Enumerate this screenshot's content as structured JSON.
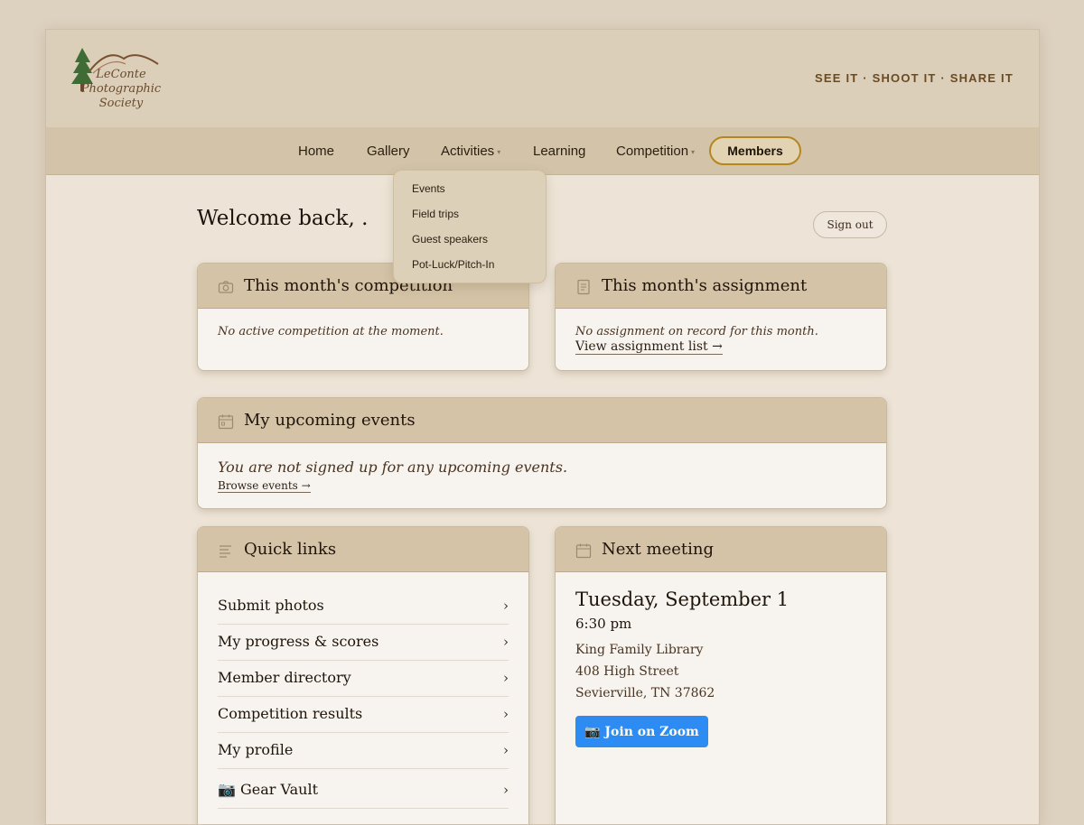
{
  "header": {
    "logo": {
      "line1": "LeConte",
      "line2": "Photographic",
      "line3": "Society"
    },
    "tagline": "SEE IT · SHOOT IT · SHARE IT"
  },
  "nav": {
    "items": [
      {
        "label": "Home"
      },
      {
        "label": "Gallery"
      },
      {
        "label": "Activities",
        "has_dropdown": true
      },
      {
        "label": "Learning"
      },
      {
        "label": "Competition",
        "has_dropdown": true
      }
    ],
    "members_label": "Members",
    "dropdown": {
      "parent": "Activities",
      "items": [
        "Events",
        "Field trips",
        "Guest speakers",
        "Pot-Luck/Pitch-In"
      ]
    }
  },
  "welcome": {
    "text": "Welcome back, .",
    "signout_label": "Sign out"
  },
  "competition_card": {
    "title": "This month's competition",
    "message": "No active competition at the moment."
  },
  "assignment_card": {
    "title": "This month's assignment",
    "message": "No assignment on record for this month.",
    "link": "View assignment list →"
  },
  "events_card": {
    "title": "My upcoming events",
    "message": "You are not signed up for any upcoming events.",
    "link": "Browse events →"
  },
  "quick_links": {
    "title": "Quick links",
    "items": [
      {
        "label": "Submit photos"
      },
      {
        "label": "My progress & scores"
      },
      {
        "label": "Member directory"
      },
      {
        "label": "Competition results"
      },
      {
        "label": "My profile"
      },
      {
        "label": "📷 Gear Vault"
      }
    ],
    "chevron": "›"
  },
  "next_meeting": {
    "title": "Next meeting",
    "date": "Tuesday, September 1",
    "time": "6:30 pm",
    "venue": "King Family Library",
    "street": "408 High Street",
    "city": "Sevierville, TN 37862",
    "zoom_label": "📷 Join on Zoom"
  },
  "colors": {
    "page_bg": "#ede4d7",
    "header_bg": "#dccfb9",
    "nav_bg": "#d3c4a9",
    "card_head_bg": "#d4c3a6",
    "members_border": "#b48620",
    "zoom_button": "#2d8cf3"
  }
}
